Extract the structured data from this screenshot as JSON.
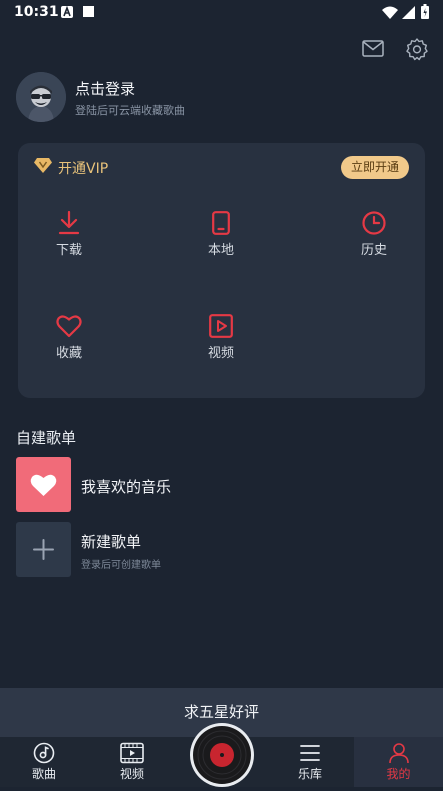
{
  "status_bar": {
    "time": "10:31",
    "icons": [
      "notification-a-icon",
      "notification-square-icon",
      "wifi-icon",
      "signal-icon",
      "battery-icon"
    ]
  },
  "header": {
    "icons": [
      "mail-icon",
      "settings-icon"
    ]
  },
  "profile": {
    "title": "点击登录",
    "subtitle": "登陆后可云端收藏歌曲"
  },
  "vip": {
    "label": "开通VIP",
    "button": "立即开通"
  },
  "quick_actions": [
    {
      "label": "下载",
      "icon": "download-icon"
    },
    {
      "label": "本地",
      "icon": "phone-icon"
    },
    {
      "label": "历史",
      "icon": "clock-icon"
    },
    {
      "label": "收藏",
      "icon": "heart-icon"
    },
    {
      "label": "视频",
      "icon": "video-icon"
    }
  ],
  "playlists": {
    "section_title": "自建歌单",
    "items": [
      {
        "title": "我喜欢的音乐",
        "subtitle": ""
      },
      {
        "title": "新建歌单",
        "subtitle": "登录后可创建歌单"
      }
    ]
  },
  "rate_bar": {
    "text": "求五星好评"
  },
  "bottom_nav": {
    "tabs": [
      {
        "label": "歌曲",
        "icon": "music-note-icon",
        "active": false
      },
      {
        "label": "视频",
        "icon": "video-icon",
        "active": false
      },
      {
        "label": "乐库",
        "icon": "menu-icon",
        "active": false
      },
      {
        "label": "我的",
        "icon": "user-icon",
        "active": true
      }
    ],
    "active_color": "#e53945"
  },
  "colors": {
    "background": "#1c2431",
    "card": "#283140",
    "accent": "#e53945",
    "vip_gold": "#e8c27a",
    "vip_button": "#f1c98a",
    "liked_cover": "#f16b79"
  }
}
